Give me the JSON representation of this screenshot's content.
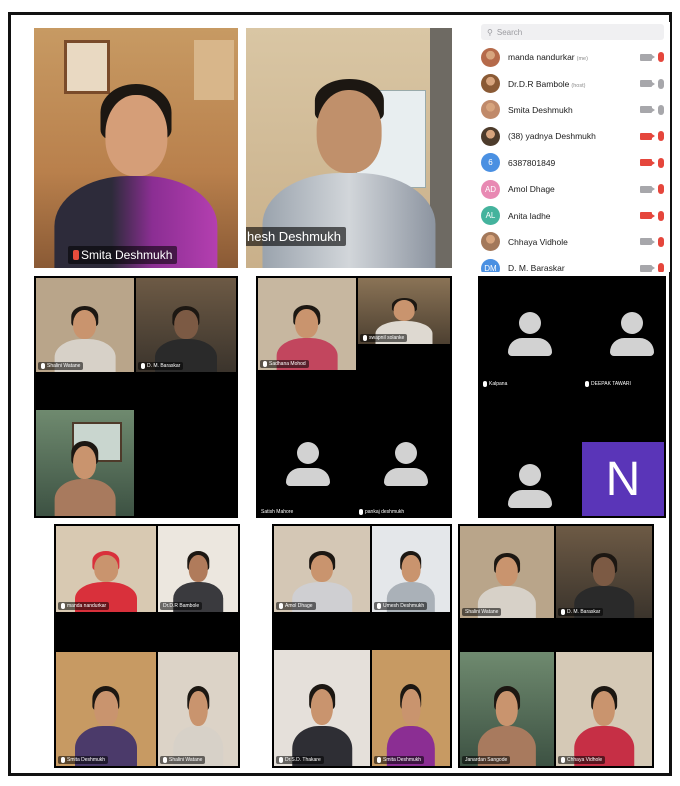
{
  "participants_list": {
    "search_placeholder": "Search",
    "search_icon": "search-icon",
    "items": [
      {
        "name": "manda nandurkar",
        "tag": "(me)",
        "avatar": "photo",
        "cam": "on",
        "mic": "muted"
      },
      {
        "name": "Dr.D.R Bambole",
        "tag": "(host)",
        "avatar": "photo",
        "cam": "on",
        "mic": "on"
      },
      {
        "name": "Smita Deshmukh",
        "tag": "",
        "avatar": "photo",
        "cam": "on",
        "mic": "on"
      },
      {
        "name": "(38) yadnya Deshmukh",
        "tag": "",
        "avatar": "photo",
        "cam": "off",
        "mic": "muted"
      },
      {
        "name": "6387801849",
        "tag": "",
        "avatar": "6",
        "avatar_color": "#4a90e2",
        "cam": "off",
        "mic": "muted"
      },
      {
        "name": "Amol Dhage",
        "tag": "",
        "avatar": "AD",
        "avatar_color": "#e889b3",
        "cam": "on",
        "mic": "muted"
      },
      {
        "name": "Anita ladhe",
        "tag": "",
        "avatar": "AL",
        "avatar_color": "#44b39d",
        "cam": "off",
        "mic": "muted"
      },
      {
        "name": "Chhaya Vidhole",
        "tag": "",
        "avatar": "photo",
        "cam": "on",
        "mic": "muted"
      },
      {
        "name": "D. M. Baraskar",
        "tag": "",
        "avatar": "DM",
        "avatar_color": "#4a90e2",
        "cam": "on",
        "mic": "muted"
      }
    ]
  },
  "top_tiles": [
    {
      "name": "Smita Deshmukh",
      "mic": "muted"
    },
    {
      "name": "hesh Deshmukh"
    }
  ],
  "row2": {
    "panel1": [
      "Shalini Watane",
      "D. M. Baraskar"
    ],
    "panel2": [
      "Sadhana Mohod",
      "swapnil solanke",
      "Satish Mahore",
      "pankaj deshmukh"
    ],
    "panel3": [
      "Kalpana",
      "DEEPAK TAWARI"
    ],
    "n_letter": "N"
  },
  "row3": {
    "panel1": [
      "manda nandurkar",
      "Dr.D.R Bambole",
      "Smita Deshmukh",
      "Shalini Watane"
    ],
    "panel2": [
      "Amol Dhage",
      "Umesh Deshmukh",
      "Dr.S.D. Thakare",
      "Smita Deshmukh"
    ],
    "panel3": [
      "Shalini Watane",
      "D. M. Baraskar",
      "Janardan Sangode",
      "Chhaya Vidhole"
    ]
  },
  "colors": {
    "muted": "#e5463c",
    "cam_on": "#a7a7ab",
    "n_tile": "#5a35b8"
  }
}
